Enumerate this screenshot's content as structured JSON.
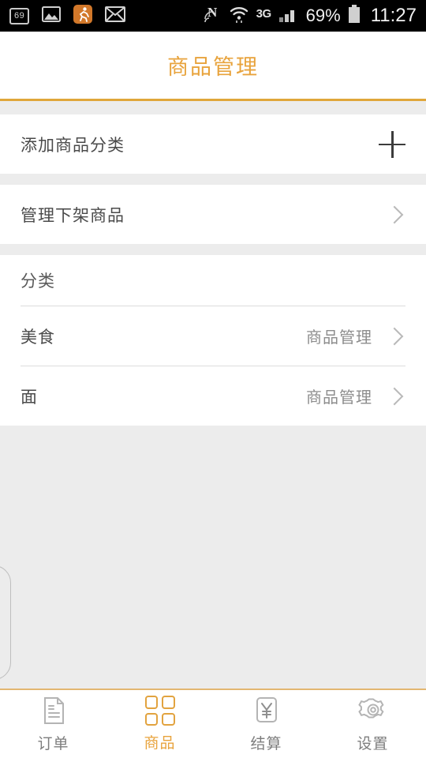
{
  "statusbar": {
    "left_icons": [
      {
        "name": "notification-count-badge",
        "label": "69"
      },
      {
        "name": "gallery-icon",
        "label": ""
      },
      {
        "name": "running-app-icon",
        "label": ""
      },
      {
        "name": "mail-icon",
        "label": ""
      }
    ],
    "nfc_icon": "nfc-icon",
    "wifi_icon": "wifi-icon",
    "network_type": "3G",
    "signal_icon": "cellular-signal-icon",
    "battery_percent": "69%",
    "battery_icon": "battery-icon",
    "time": "11:27"
  },
  "header": {
    "title": "商品管理"
  },
  "actions": [
    {
      "label": "添加商品分类",
      "icon": "plus-icon",
      "name": "add-category"
    },
    {
      "label": "管理下架商品",
      "icon": "chevron-right-icon",
      "name": "manage-offshelf"
    }
  ],
  "category_section": {
    "title": "分类",
    "items": [
      {
        "name": "美食",
        "action_label": "商品管理"
      },
      {
        "name": "面",
        "action_label": "商品管理"
      }
    ]
  },
  "navbar": {
    "items": [
      {
        "label": "订单",
        "icon": "document-icon",
        "active": false
      },
      {
        "label": "商品",
        "icon": "grid-icon",
        "active": true
      },
      {
        "label": "结算",
        "icon": "yen-icon",
        "active": false
      },
      {
        "label": "设置",
        "icon": "gear-icon",
        "active": false
      }
    ]
  },
  "colors": {
    "accent": "#e8a33c",
    "header_border": "#e0a63a",
    "text_primary": "#4a4a4a",
    "text_secondary": "#8d8d8d",
    "page_bg": "#ececec"
  }
}
